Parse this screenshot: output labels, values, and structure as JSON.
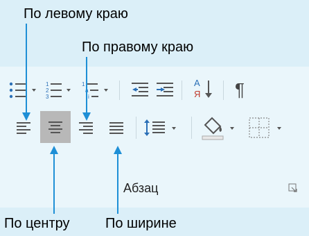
{
  "callouts": {
    "align_left": "По левому краю",
    "align_right": "По правому краю",
    "align_center": "По центру",
    "justify": "По ширине"
  },
  "ribbon": {
    "group_label": "Абзац",
    "selected_button": "align-center",
    "colors": {
      "accent_arrow": "#1e8fd6",
      "icon_blue": "#2a6fb6",
      "icon_gray": "#555555",
      "selected_bg": "#b8b8b8"
    }
  }
}
